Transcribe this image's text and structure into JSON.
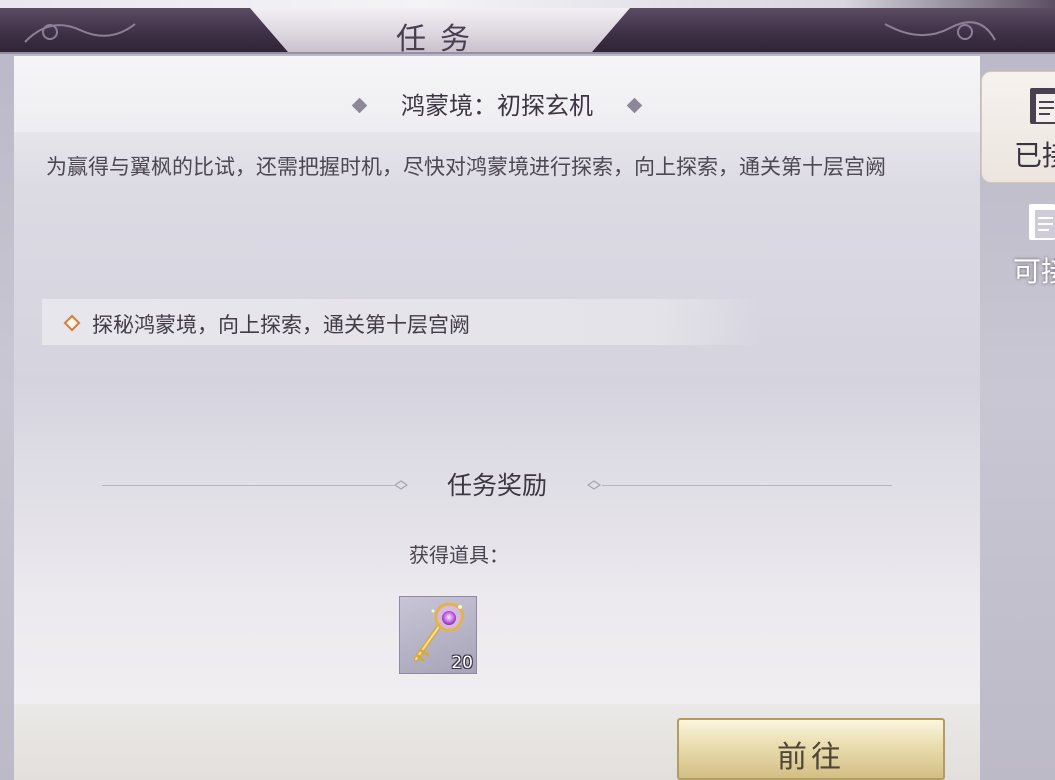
{
  "header": {
    "title": "任务"
  },
  "task": {
    "title": "鸿蒙境：初探玄机",
    "description": "为赢得与翼枫的比试，还需把握时机，尽快对鸿蒙境进行探索，向上探索，通关第十层宫阙",
    "objectives": [
      {
        "text": "探秘鸿蒙境，向上探索，通关第十层宫阙"
      }
    ]
  },
  "rewards": {
    "title": "任务奖励",
    "subtitle": "获得道具：",
    "items": [
      {
        "icon": "golden-key-icon",
        "count": "20"
      }
    ]
  },
  "actions": {
    "goto_label": "前往"
  },
  "side_tabs": [
    {
      "label": "已接",
      "icon": "scroll-icon",
      "active": true
    },
    {
      "label": "可接",
      "icon": "scroll-icon",
      "active": false
    }
  ],
  "colors": {
    "accent_gold": "#e9dcae",
    "title_bar": "#3f3147",
    "objective_bullet": "#d67d3d"
  }
}
